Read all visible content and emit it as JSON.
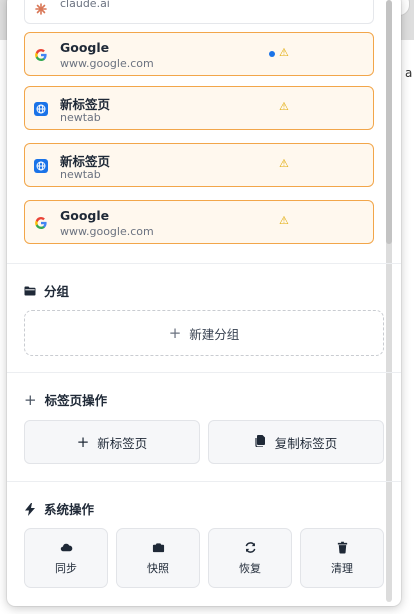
{
  "tabs": [
    {
      "title": "",
      "url": "claude.ai",
      "favicon": "claude-icon",
      "warning": false,
      "active": false,
      "partial": true
    },
    {
      "title": "Google",
      "url": "www.google.com",
      "favicon": "google-icon",
      "warning": true,
      "active": true
    },
    {
      "title": "新标签页",
      "url": "newtab",
      "favicon": "globe-icon",
      "warning": true,
      "active": false
    },
    {
      "title": "新标签页",
      "url": "newtab",
      "favicon": "globe-icon",
      "warning": true,
      "active": false
    },
    {
      "title": "Google",
      "url": "www.google.com",
      "favicon": "google-icon",
      "warning": true,
      "active": false
    }
  ],
  "warning_symbol": "⚠",
  "groups": {
    "title": "分组",
    "new_group_label": "新建分组",
    "plus": "+"
  },
  "tab_actions": {
    "title": "标签页操作",
    "new_tab_label": "新标签页",
    "duplicate_tab_label": "复制标签页",
    "plus": "+"
  },
  "system_actions": {
    "title": "系统操作",
    "buttons": [
      {
        "label": "同步",
        "icon": "cloud-icon"
      },
      {
        "label": "快照",
        "icon": "camera-icon"
      },
      {
        "label": "恢复",
        "icon": "refresh-icon"
      },
      {
        "label": "清理",
        "icon": "trash-icon"
      }
    ]
  },
  "background": {
    "edge_char": "a"
  },
  "colors": {
    "card_bg": "#fff8ee",
    "card_border": "#f2a64a",
    "warning": "#e0a800",
    "active_dot": "#1a73e8"
  }
}
